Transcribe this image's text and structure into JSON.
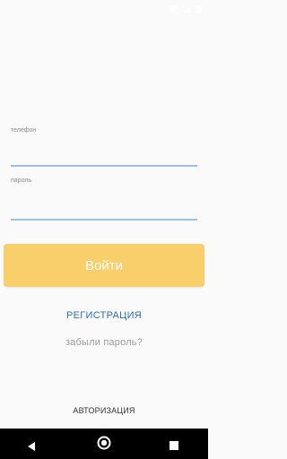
{
  "status_bar": {
    "icons": [
      "wifi-icon",
      "signal-icon",
      "battery-icon"
    ]
  },
  "form": {
    "phone_label": "телефон",
    "phone_value": "",
    "password_label": "пароль",
    "password_value": ""
  },
  "actions": {
    "login_label": "Войти",
    "register_label": "РЕГИСТРАЦИЯ",
    "forgot_label": "забыли пароль?"
  },
  "bottom_tab": {
    "label": "АВТОРИЗАЦИЯ"
  },
  "nav_bar": {
    "icons": [
      "back-icon",
      "home-icon",
      "recent-apps-icon"
    ]
  },
  "colors": {
    "accent_button": "#f8cf6b",
    "link": "#2f6db3",
    "input_underline": "#9fc0e6",
    "background": "#fafafa"
  }
}
